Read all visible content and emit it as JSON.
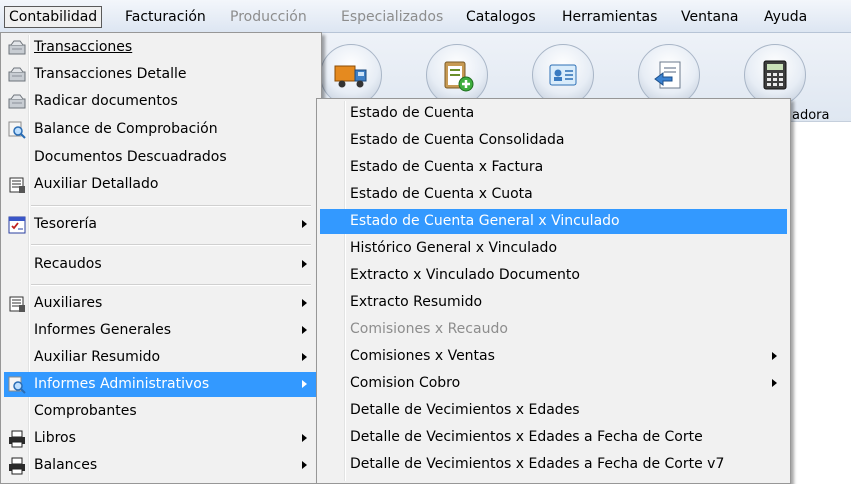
{
  "menubar": {
    "items": [
      {
        "label": "Contabilidad",
        "state": "active"
      },
      {
        "label": "Facturación",
        "state": "normal"
      },
      {
        "label": "Producción",
        "state": "disabled"
      },
      {
        "label": "Especializados",
        "state": "disabled"
      },
      {
        "label": "Catalogos",
        "state": "normal"
      },
      {
        "label": "Herramientas",
        "state": "normal"
      },
      {
        "label": "Ventana",
        "state": "normal"
      },
      {
        "label": "Ayuda",
        "state": "normal"
      }
    ]
  },
  "toolbar": {
    "buttons": [
      {
        "icon": "truck-icon"
      },
      {
        "icon": "clipboard-add-icon"
      },
      {
        "icon": "id-card-icon"
      },
      {
        "icon": "document-return-icon"
      },
      {
        "icon": "calculator-icon"
      }
    ],
    "partial_label": "adora"
  },
  "menu_contabilidad": {
    "items": [
      {
        "label": "Transacciones",
        "icon": "transactions-icon",
        "submenu": false
      },
      {
        "label": "Transacciones Detalle",
        "icon": "transactions-icon",
        "submenu": false
      },
      {
        "label": "Radicar documentos",
        "icon": "transactions-icon",
        "submenu": false
      },
      {
        "label": "Balance de Comprobación",
        "icon": "magnifier-icon",
        "submenu": false
      },
      {
        "label": "Documentos Descuadrados",
        "icon": "",
        "submenu": false
      },
      {
        "label": "Auxiliar Detallado",
        "icon": "ledger-icon",
        "submenu": false
      },
      {
        "label": "Tesorería",
        "icon": "treasury-icon",
        "submenu": true
      },
      {
        "label": "Recaudos",
        "icon": "",
        "submenu": true
      },
      {
        "label": "Auxiliares",
        "icon": "ledger-icon",
        "submenu": true
      },
      {
        "label": "Informes Generales",
        "icon": "",
        "submenu": true
      },
      {
        "label": "Auxiliar Resumido",
        "icon": "",
        "submenu": true
      },
      {
        "label": "Informes Administrativos",
        "icon": "magnifier-icon",
        "submenu": true,
        "highlighted": true
      },
      {
        "label": "Comprobantes",
        "icon": "",
        "submenu": false
      },
      {
        "label": "Libros",
        "icon": "printer-icon",
        "submenu": true
      },
      {
        "label": "Balances",
        "icon": "printer-icon",
        "submenu": true
      }
    ]
  },
  "menu_informes": {
    "items": [
      {
        "label": "Estado de Cuenta",
        "submenu": false
      },
      {
        "label": "Estado de Cuenta Consolidada",
        "submenu": false
      },
      {
        "label": "Estado de Cuenta x Factura",
        "submenu": false
      },
      {
        "label": "Estado de Cuenta x Cuota",
        "submenu": false
      },
      {
        "label": "Estado de Cuenta General x Vinculado",
        "submenu": false,
        "highlighted": true
      },
      {
        "label": "Histórico General x Vinculado",
        "submenu": false
      },
      {
        "label": "Extracto x Vinculado Documento",
        "submenu": false
      },
      {
        "label": "Extracto Resumido",
        "submenu": false
      },
      {
        "label": "Comisiones x Recaudo",
        "submenu": false,
        "disabled": true
      },
      {
        "label": "Comisiones x Ventas",
        "submenu": true
      },
      {
        "label": "Comision Cobro",
        "submenu": true
      },
      {
        "label": "Detalle de Vecimientos x Edades",
        "submenu": false
      },
      {
        "label": "Detalle de Vecimientos x Edades a Fecha de Corte",
        "submenu": false
      },
      {
        "label": "Detalle de Vecimientos x Edades a Fecha de Corte v7",
        "submenu": false
      }
    ]
  },
  "colors": {
    "highlight": "#3399ff",
    "menu_bg": "#f1f1f1",
    "disabled_text": "#8d8d8d"
  }
}
